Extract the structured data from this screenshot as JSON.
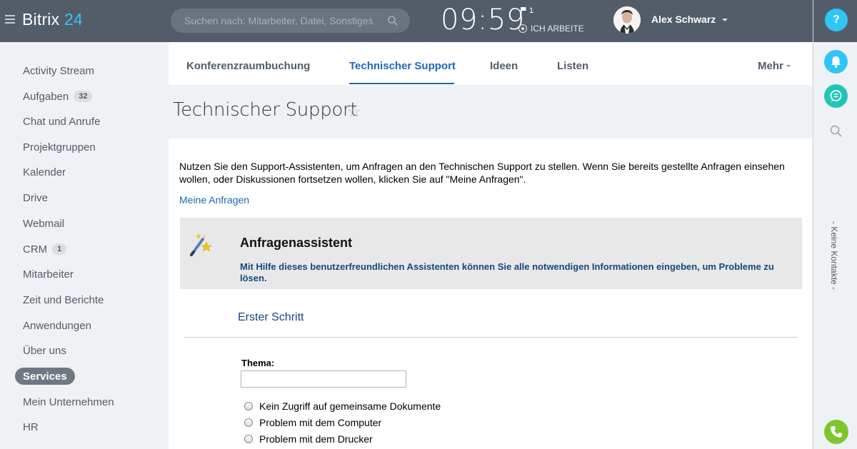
{
  "header": {
    "logo_brand": "Bitrix",
    "logo_number": "24",
    "search_placeholder": "Suchen nach: Mitarbeiter, Datei, Sonstiges",
    "clock": "09:59",
    "flag_count": "1",
    "work_status": "ICH ARBEITE",
    "user_name": "Alex Schwarz"
  },
  "sidebar": {
    "items": [
      {
        "label": "Activity Stream",
        "badge": ""
      },
      {
        "label": "Aufgaben",
        "badge": "32"
      },
      {
        "label": "Chat und Anrufe",
        "badge": ""
      },
      {
        "label": "Projektgruppen",
        "badge": ""
      },
      {
        "label": "Kalender",
        "badge": ""
      },
      {
        "label": "Drive",
        "badge": ""
      },
      {
        "label": "Webmail",
        "badge": ""
      },
      {
        "label": "CRM",
        "badge": "1"
      },
      {
        "label": "Mitarbeiter",
        "badge": ""
      },
      {
        "label": "Zeit und Berichte",
        "badge": ""
      },
      {
        "label": "Anwendungen",
        "badge": ""
      },
      {
        "label": "Über uns",
        "badge": ""
      },
      {
        "label": "Services",
        "badge": "",
        "active": true
      },
      {
        "label": "Mein Unternehmen",
        "badge": ""
      },
      {
        "label": "HR",
        "badge": ""
      }
    ]
  },
  "tabs": {
    "items": [
      "Konferenzraumbuchung",
      "Technischer Support",
      "Ideen",
      "Listen"
    ],
    "active": "Technischer Support",
    "more": "Mehr"
  },
  "page": {
    "title": "Technischer Support",
    "intro": "Nutzen Sie den Support-Assistenten, um Anfragen an den Technischen Support zu stellen. Wenn Sie bereits gestellte Anfragen einsehen wollen, oder Diskussionen fortsetzen wollen, klicken Sie auf \"Meine Anfragen\".",
    "my_requests_link": "Meine Anfragen",
    "wizard_title": "Anfragenassistent",
    "wizard_desc": "Mit Hilfe dieses benutzerfreundlichen Assistenten können Sie alle notwendigen Informationen eingeben, um Probleme zu lösen.",
    "step_title": "Erster Schritt",
    "topic_label": "Thema:",
    "topic_value": "",
    "options": [
      "Kein Zugriff auf gemeinsame Dokumente",
      "Problem mit dem Computer",
      "Problem mit dem Drucker"
    ]
  },
  "rightbar": {
    "help_label": "?",
    "contacts_label": "- Keine Kontakte -"
  },
  "colors": {
    "header_bg": "#535c69",
    "accent_blue": "#2067b0",
    "logo_accent": "#2fc6f6",
    "chat_green": "#1ec6b6",
    "phone_green": "#7fc62c"
  }
}
